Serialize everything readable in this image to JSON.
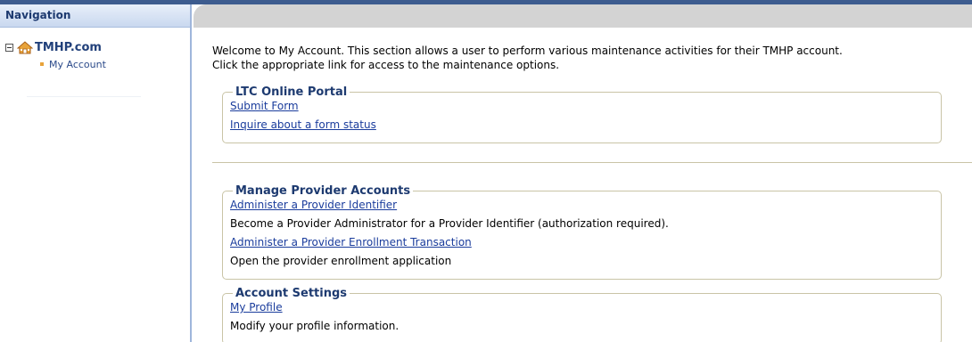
{
  "sidebar": {
    "header": "Navigation",
    "tree": {
      "root_label": "TMHP.com",
      "root_icon": "home-icon",
      "children": [
        {
          "label": "My Account"
        }
      ]
    }
  },
  "main": {
    "intro_line1": "Welcome to My Account. This section allows a user to perform various maintenance activities for their TMHP account.",
    "intro_line2": "Click the appropriate link for access to the maintenance options.",
    "sections": [
      {
        "title": "LTC Online Portal",
        "rows": [
          {
            "type": "link",
            "text": "Submit Form"
          },
          {
            "type": "link",
            "text": "Inquire about a form status"
          }
        ]
      },
      {
        "title": "Manage Provider Accounts",
        "rows": [
          {
            "type": "link",
            "text": "Administer a Provider Identifier"
          },
          {
            "type": "text",
            "text": "Become a Provider Administrator for a Provider Identifier (authorization required)."
          },
          {
            "type": "link",
            "text": "Administer a Provider Enrollment Transaction"
          },
          {
            "type": "text",
            "text": "Open the provider enrollment application"
          }
        ]
      },
      {
        "title": "Account Settings",
        "rows": [
          {
            "type": "link",
            "text": "My Profile"
          },
          {
            "type": "text",
            "text": "Modify your profile information."
          }
        ]
      }
    ]
  },
  "colors": {
    "header_text": "#1d3a70",
    "link": "#1a3c9c",
    "bullet": "#e8a33a",
    "sidebar_border": "#9fb6db",
    "header_bar": "#d3d3d3"
  }
}
